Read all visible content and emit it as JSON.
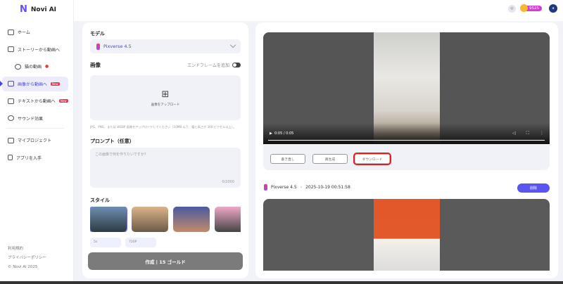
{
  "app": {
    "name": "Novi AI"
  },
  "sidebar": {
    "items": [
      {
        "label": "ホーム"
      },
      {
        "label": "ストーリーから動画へ"
      },
      {
        "label": "猫の動画"
      },
      {
        "label": "画像から動画へ",
        "badge": "New",
        "active": true
      },
      {
        "label": "テキストから動画へ",
        "badge": "New"
      },
      {
        "label": "サウンド効果"
      },
      {
        "label": "マイプロジェクト"
      },
      {
        "label": "アプリを入手"
      }
    ],
    "footer": [
      "利用規約",
      "プライバシーポリシー",
      "© Novi AI 2025"
    ]
  },
  "topbar": {
    "gold": "9525",
    "avatar": "a"
  },
  "form": {
    "model_label": "モデル",
    "model": "Pixverse 4.5",
    "image_label": "画像",
    "end_frame": "エンドフレームを追加",
    "upload": "画像をアップロード",
    "hint": "JPG、PNG、または WEBP 画像をアップロードしてください（10MB 以下、幅と高さが 300 ピクセル以上）。",
    "prompt_label": "プロンプト（任意）",
    "prompt_placeholder": "この画像で何を作りたいですか？",
    "count": "0/2000",
    "style_label": "スタイル",
    "duration": "5s",
    "resolution": "720P",
    "create": "作成 | 15 ゴールド"
  },
  "result": {
    "time": "0:05 / 0:05",
    "buttons": [
      "書き直し",
      "再生成",
      "ダウンロード"
    ],
    "model": "Pixverse 4.5",
    "timestamp": "2025-10-19 00:51:58",
    "delete": "削除"
  }
}
